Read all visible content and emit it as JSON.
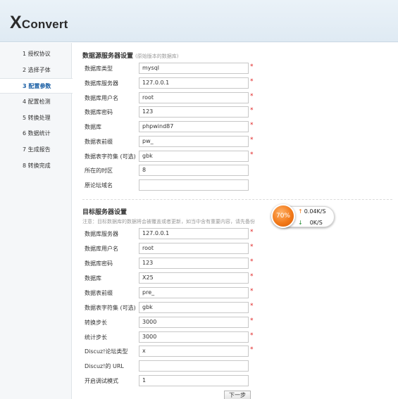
{
  "logo": {
    "big": "X",
    "rest": "Convert"
  },
  "sidebar": {
    "items": [
      {
        "label": "1  授权协议"
      },
      {
        "label": "2  选择子体"
      },
      {
        "label": "3  配置参数"
      },
      {
        "label": "4  配置检测"
      },
      {
        "label": "5  转换处理"
      },
      {
        "label": "6  数据统计"
      },
      {
        "label": "7  生成报告"
      },
      {
        "label": "8  转换完成"
      }
    ],
    "active_index": 2
  },
  "source": {
    "title": "数据源服务器设置",
    "note": "(原始版本的数据库)",
    "fields": [
      {
        "label": "数据库类型",
        "value": "mysql",
        "required": "*"
      },
      {
        "label": "数据库服务器",
        "value": "127.0.0.1",
        "required": "*"
      },
      {
        "label": "数据库用户名",
        "value": "root",
        "required": "*"
      },
      {
        "label": "数据库密码",
        "value": "123",
        "required": "*"
      },
      {
        "label": "数据库",
        "value": "phpwind87",
        "required": "*"
      },
      {
        "label": "数据表前缀",
        "value": "pw_",
        "required": "*"
      },
      {
        "label": "数据表字符集 (可选)",
        "value": "gbk",
        "required": "*"
      },
      {
        "label": "所在的时区",
        "value": "8",
        "required": ""
      },
      {
        "label": "原论坛域名",
        "value": "",
        "required": ""
      }
    ]
  },
  "target": {
    "title": "目标服务器设置",
    "notice": "注意：目标数据库的数据将会被覆盖或者更新，如当中含有重要内容，请先备份",
    "fields": [
      {
        "label": "数据库服务器",
        "value": "127.0.0.1",
        "required": "*"
      },
      {
        "label": "数据库用户名",
        "value": "root",
        "required": "*"
      },
      {
        "label": "数据库密码",
        "value": "123",
        "required": "*"
      },
      {
        "label": "数据库",
        "value": "X25",
        "required": "*"
      },
      {
        "label": "数据表前缀",
        "value": "pre_",
        "required": "*"
      },
      {
        "label": "数据表字符集 (可选)",
        "value": "gbk",
        "required": "*"
      },
      {
        "label": "转换步长",
        "value": "3000",
        "required": "*"
      },
      {
        "label": "统计步长",
        "value": "3000",
        "required": "*"
      },
      {
        "label": "Discuz!论坛类型",
        "value": "x",
        "required": "*"
      },
      {
        "label": "Discuz!的 URL",
        "value": "",
        "required": ""
      },
      {
        "label": "开启调试模式",
        "value": "1",
        "required": ""
      }
    ]
  },
  "next_button": "下一步",
  "speed_widget": {
    "percent": "70%",
    "up": "0.04K/S",
    "down": "0K/S"
  }
}
